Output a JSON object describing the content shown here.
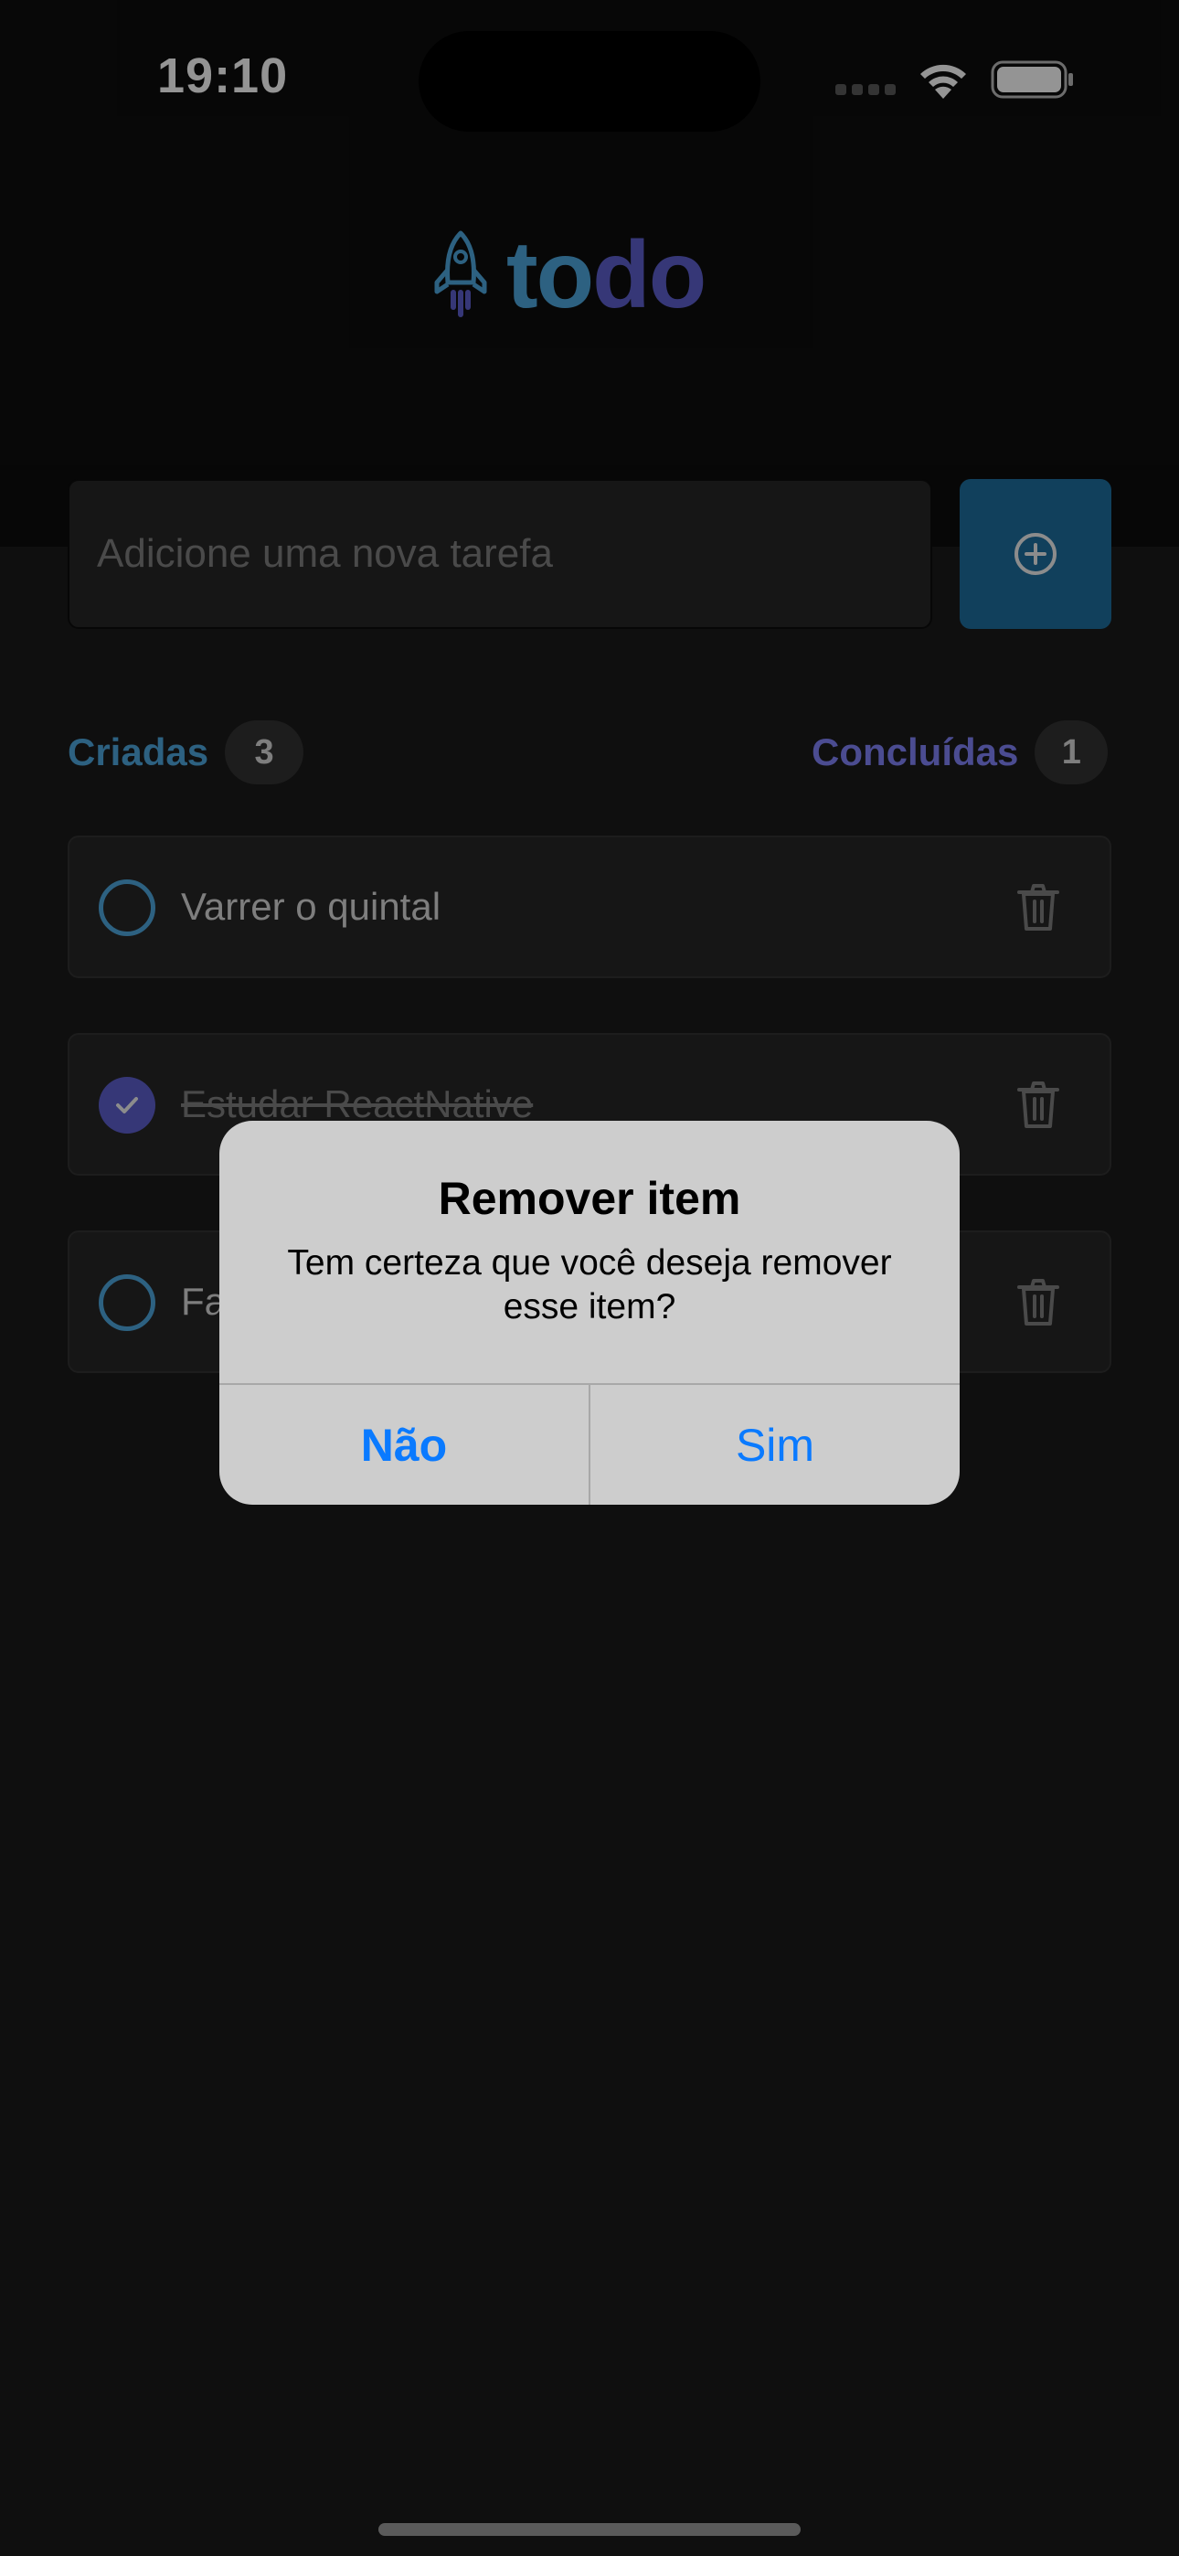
{
  "status_bar": {
    "time": "19:10"
  },
  "app": {
    "logo_part1": "to",
    "logo_part2": "do"
  },
  "input": {
    "placeholder": "Adicione uma nova tarefa"
  },
  "counters": {
    "created_label": "Criadas",
    "created_count": "3",
    "done_label": "Concluídas",
    "done_count": "1"
  },
  "tasks": [
    {
      "text": "Varrer o quintal",
      "done": false
    },
    {
      "text": "Estudar ReactNative",
      "done": true
    },
    {
      "text": "Fa",
      "done": false
    }
  ],
  "alert": {
    "title": "Remover item",
    "message": "Tem certeza que você deseja remover esse item?",
    "cancel_label": "Não",
    "confirm_label": "Sim"
  },
  "colors": {
    "blue": "#4ea8de",
    "purple": "#5e60ce",
    "button": "#1e6f9f",
    "alert_link": "#0a7aff"
  }
}
